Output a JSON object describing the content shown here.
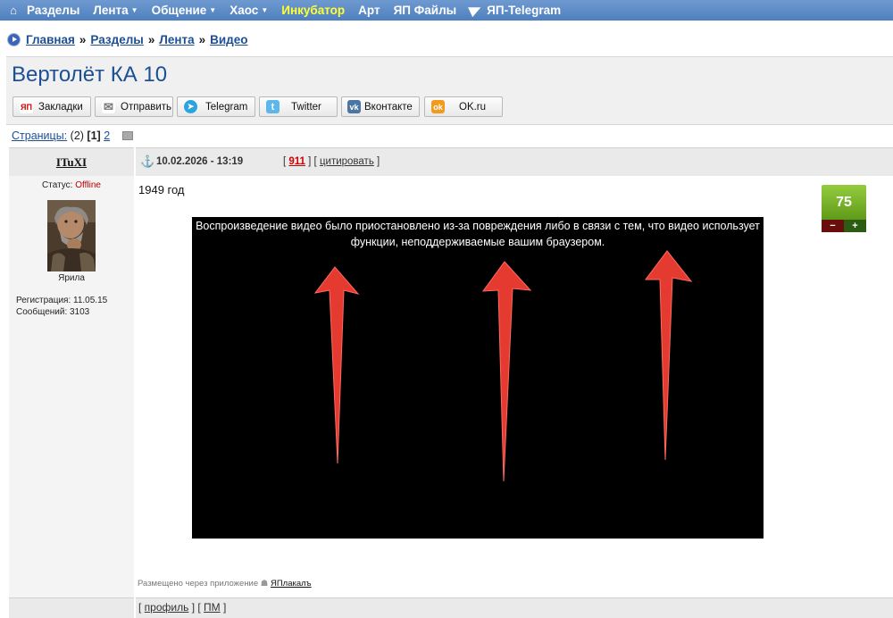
{
  "nav": {
    "items": [
      {
        "label": "Разделы",
        "caret": false,
        "highlight": false
      },
      {
        "label": "Лента",
        "caret": true,
        "highlight": false
      },
      {
        "label": "Общение",
        "caret": true,
        "highlight": false
      },
      {
        "label": "Хаос",
        "caret": true,
        "highlight": false
      },
      {
        "label": "Инкубатор",
        "caret": false,
        "highlight": true
      },
      {
        "label": "Арт",
        "caret": false,
        "highlight": false
      },
      {
        "label": "ЯП Файлы",
        "caret": false,
        "highlight": false
      }
    ],
    "telegram": "ЯП-Telegram",
    "caret_glyph": "▼",
    "home_glyph": "⌂"
  },
  "breadcrumb": {
    "items": [
      "Главная",
      "Разделы",
      "Лента",
      "Видео"
    ],
    "separator": "»"
  },
  "title": "Вертолёт КА 10",
  "share": {
    "buttons": [
      {
        "label": "Закладки",
        "icon": "yap-icon",
        "glyph": "ЯП",
        "color": "#ffffff",
        "fg": "#d40000"
      },
      {
        "label": "Отправить",
        "icon": "envelope-icon",
        "glyph": "✉",
        "color": "#ffffff",
        "fg": "#777777"
      },
      {
        "label": "Telegram",
        "icon": "telegram-icon",
        "glyph": "➤",
        "color": "#2aa3df",
        "fg": "#ffffff"
      },
      {
        "label": "Twitter",
        "icon": "twitter-icon",
        "glyph": "t",
        "color": "#5eb7ea",
        "fg": "#ffffff"
      },
      {
        "label": "Вконтакте",
        "icon": "vk-icon",
        "glyph": "vk",
        "color": "#4c75a3",
        "fg": "#ffffff"
      },
      {
        "label": "OK.ru",
        "icon": "ok-icon",
        "glyph": "ok",
        "color": "#f29a1c",
        "fg": "#ffffff"
      }
    ]
  },
  "pages": {
    "label": "Страницы:",
    "count": "(2)",
    "current": "[1]",
    "next": "2"
  },
  "post": {
    "author": "ITuXI",
    "date": "10.02.2026 - 13:19",
    "number": "911",
    "cite": "цитировать",
    "status_label": "Статус:",
    "status_value": "Offline",
    "avatar_name": "Ярила",
    "registration": "Регистрация: 11.05.15",
    "messages": "Сообщений: 3103",
    "text": "1949 год",
    "video_message": "Воспроизведение видео было приостановлено из-за повреждения либо в связи с тем, что видео использует функции, неподдерживаемые вашим браузером.",
    "rating": "75",
    "rating_minus": "−",
    "rating_plus": "+",
    "via_text": "Размещено через приложение",
    "via_app": "ЯПлакалъ",
    "profile": "профиль",
    "pm": "ПМ"
  },
  "colors": {
    "nav_bg": "#5a88c6",
    "link": "#1d4f95",
    "offline": "#b00000",
    "arrow": "#e53a30",
    "rating_green": "#7ab52b"
  }
}
